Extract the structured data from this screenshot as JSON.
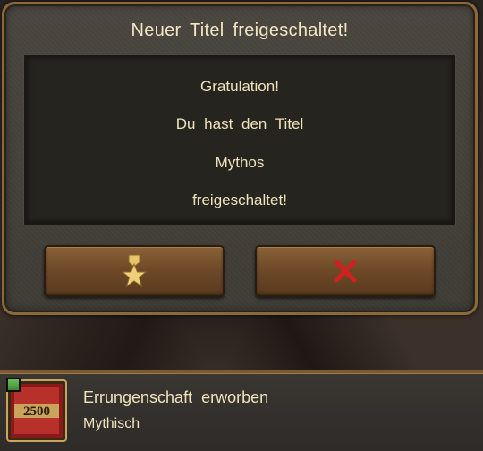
{
  "dialog": {
    "title": "Neuer Titel freigeschaltet!",
    "message": {
      "line1": "Gratulation!",
      "line2": "Du hast den Titel",
      "line3": "Mythos",
      "line4": "freigeschaltet!"
    },
    "buttons": {
      "confirm_icon": "star-medal-icon",
      "close_icon": "red-x-icon"
    }
  },
  "notification": {
    "title": "Errungenschaft erworben",
    "subtitle": "Mythisch",
    "badge_value": "2500",
    "checked": true
  },
  "colors": {
    "text": "#f0e2bd",
    "frame": "#8a6a3a",
    "button": "#6e4a28",
    "close_red": "#d02020",
    "star_gold": "#e8c46a"
  }
}
